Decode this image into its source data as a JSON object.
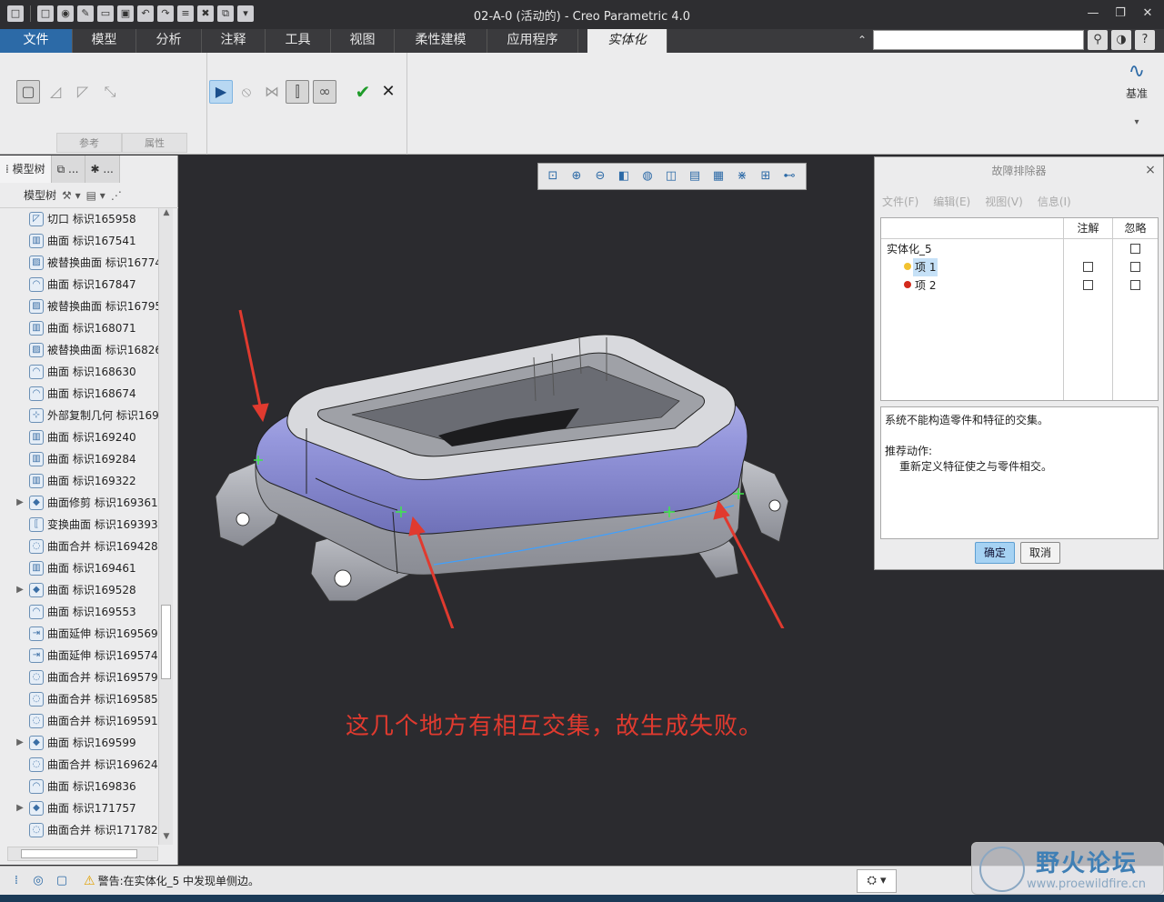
{
  "window": {
    "title": "02-A-0 (活动的) - Creo Parametric 4.0",
    "minimize": "—",
    "restore": "❐",
    "close": "✕"
  },
  "quick_access": [
    "□",
    "◉",
    "✎",
    "▭",
    "▣",
    "↶",
    "↷",
    "≡",
    "✖",
    "⧉",
    "▾"
  ],
  "menu": {
    "tabs": [
      {
        "label": "文件"
      },
      {
        "label": "模型"
      },
      {
        "label": "分析"
      },
      {
        "label": "注释"
      },
      {
        "label": "工具"
      },
      {
        "label": "视图"
      },
      {
        "label": "柔性建模"
      },
      {
        "label": "应用程序"
      },
      {
        "label": "实体化"
      }
    ],
    "search_placeholder": "",
    "collapse": "⌃",
    "search_icon": "⚲",
    "help_icon": "◑",
    "more_icon": "?"
  },
  "ribbon": {
    "ref_tab": "参考",
    "props_tab": "属性",
    "datum_label": "基准",
    "datum_icon": "∿",
    "datum_more": "▾",
    "ok_icon": "✔",
    "cancel_icon": "✕"
  },
  "left_panel": {
    "tabs": [
      "模型树",
      "...",
      "..."
    ],
    "toolbar_label": "模型树",
    "tree": [
      {
        "label": "切口 标识165958",
        "expand": ""
      },
      {
        "label": "曲面 标识167541",
        "expand": ""
      },
      {
        "label": "被替换曲面 标识16774",
        "expand": ""
      },
      {
        "label": "曲面 标识167847",
        "expand": ""
      },
      {
        "label": "被替换曲面 标识16795",
        "expand": ""
      },
      {
        "label": "曲面 标识168071",
        "expand": ""
      },
      {
        "label": "被替换曲面 标识16826",
        "expand": ""
      },
      {
        "label": "曲面 标识168630",
        "expand": ""
      },
      {
        "label": "曲面 标识168674",
        "expand": ""
      },
      {
        "label": "外部复制几何 标识169",
        "expand": ""
      },
      {
        "label": "曲面 标识169240",
        "expand": ""
      },
      {
        "label": "曲面 标识169284",
        "expand": ""
      },
      {
        "label": "曲面 标识169322",
        "expand": ""
      },
      {
        "label": "曲面修剪 标识169361",
        "expand": "▶"
      },
      {
        "label": "变换曲面 标识169393",
        "expand": ""
      },
      {
        "label": "曲面合并 标识169428",
        "expand": ""
      },
      {
        "label": "曲面 标识169461",
        "expand": ""
      },
      {
        "label": "曲面 标识169528",
        "expand": "▶"
      },
      {
        "label": "曲面 标识169553",
        "expand": ""
      },
      {
        "label": "曲面延伸 标识169569",
        "expand": ""
      },
      {
        "label": "曲面延伸 标识169574",
        "expand": ""
      },
      {
        "label": "曲面合并 标识169579",
        "expand": ""
      },
      {
        "label": "曲面合并 标识169585",
        "expand": ""
      },
      {
        "label": "曲面合并 标识169591",
        "expand": ""
      },
      {
        "label": "曲面 标识169599",
        "expand": "▶"
      },
      {
        "label": "曲面合并 标识169624",
        "expand": ""
      },
      {
        "label": "曲面 标识169836",
        "expand": ""
      },
      {
        "label": "曲面 标识171757",
        "expand": "▶"
      },
      {
        "label": "曲面合并 标识171782",
        "expand": ""
      }
    ]
  },
  "viewport": {
    "annotation": "这几个地方有相互交集，故生成失败。",
    "view_tools": [
      "⊡",
      "⊕",
      "⊖",
      "◧",
      "◍",
      "◫",
      "▤",
      "▦",
      "⋇",
      "⊞",
      "⊷"
    ]
  },
  "dialog": {
    "title": "故障排除器",
    "close": "×",
    "menu": [
      "文件(F)",
      "编辑(E)",
      "视图(V)",
      "信息(I)"
    ],
    "col_note": "注解",
    "col_ignore": "忽略",
    "root": "实体化_5",
    "items": [
      {
        "label": "项 1",
        "dot": "#f2c230"
      },
      {
        "label": "项 2",
        "dot": "#d32a1c"
      }
    ],
    "message_line1": "系统不能构造零件和特征的交集。",
    "action_title": "推荐动作:",
    "action_text": "重新定义特征使之与零件相交。",
    "ok": "确定",
    "cancel": "取消"
  },
  "status": {
    "warning": "警告:在实体化_5 中发现单侧边。",
    "filter_icon": "⛭ ▾"
  },
  "watermark": {
    "title": "野火论坛",
    "url": "www.proewildfire.cn"
  }
}
